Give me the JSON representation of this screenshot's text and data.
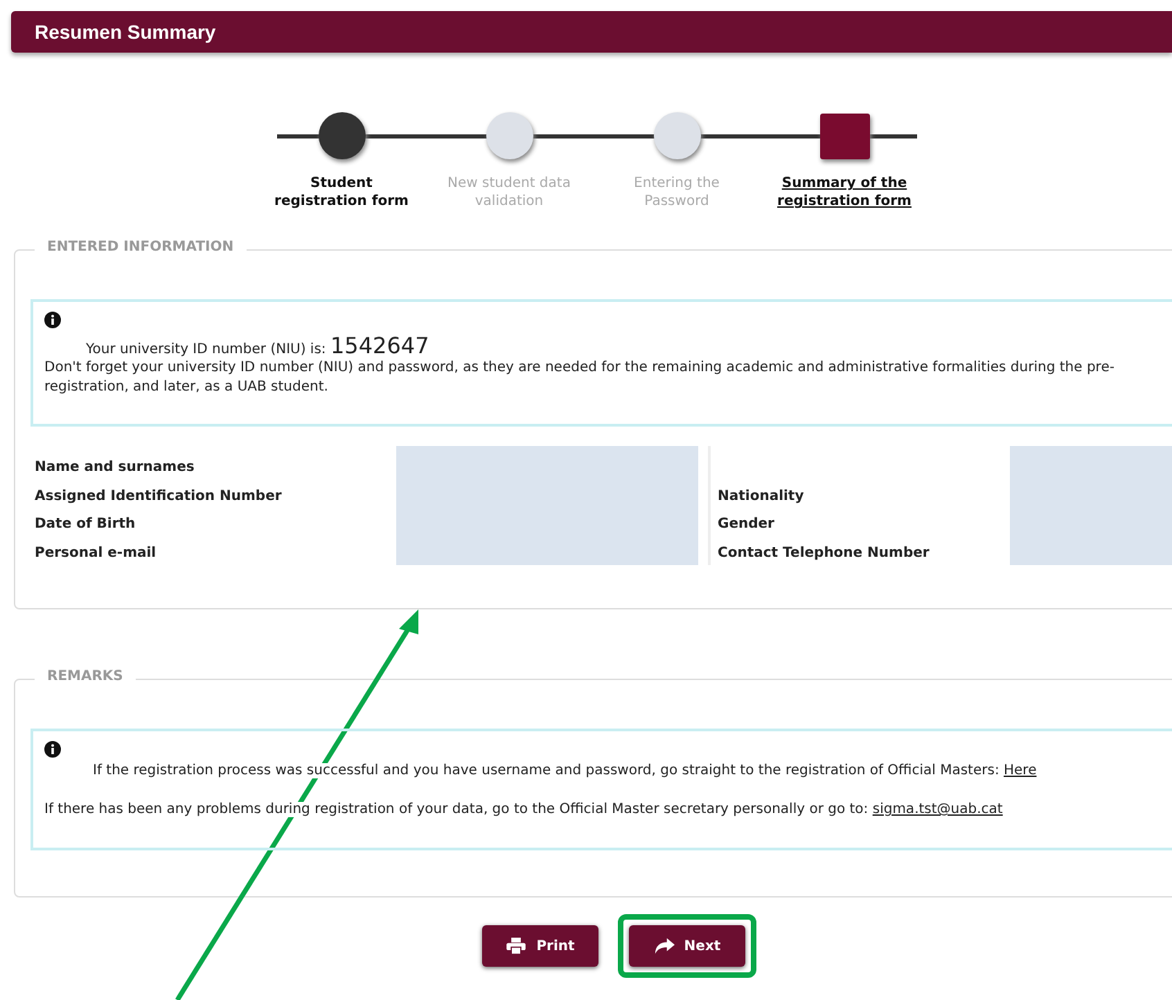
{
  "header": {
    "title": "Resumen Summary"
  },
  "steps": [
    {
      "label": "Student registration form",
      "completed": true,
      "current": false
    },
    {
      "label": "New student data validation",
      "completed": false,
      "current": false
    },
    {
      "label": "Entering the Password",
      "completed": false,
      "current": false
    },
    {
      "label": "Summary of the registration form",
      "completed": false,
      "current": true
    }
  ],
  "entered_information": {
    "legend": "ENTERED INFORMATION",
    "notice": {
      "niu_label": "Your university ID number (NIU) is:",
      "niu": "1542647",
      "text": "Don't forget your university ID number (NIU) and password, as they are needed for the remaining academic and administrative formalities during the pre-registration, and later, as a UAB student."
    },
    "left_labels": [
      "Name and surnames",
      "Assigned Identification Number",
      "Date of Birth",
      "Personal e-mail"
    ],
    "right_labels": [
      "Nationality",
      "Gender",
      "Contact Telephone Number"
    ]
  },
  "remarks": {
    "legend": "REMARKS",
    "line_1": "If the registration process was successful and you have username and password, go straight to the registration of Official Masters:",
    "link_1": "Here",
    "line_2": "If there has been any problems during registration of your data, go to the Official Master secretary personally or go to:",
    "link_2": "sigma.tst@uab.cat"
  },
  "buttons": [
    {
      "label": "Print",
      "kind": "print",
      "highlighted": false
    },
    {
      "label": "Next",
      "kind": "next",
      "highlighted": true
    }
  ]
}
